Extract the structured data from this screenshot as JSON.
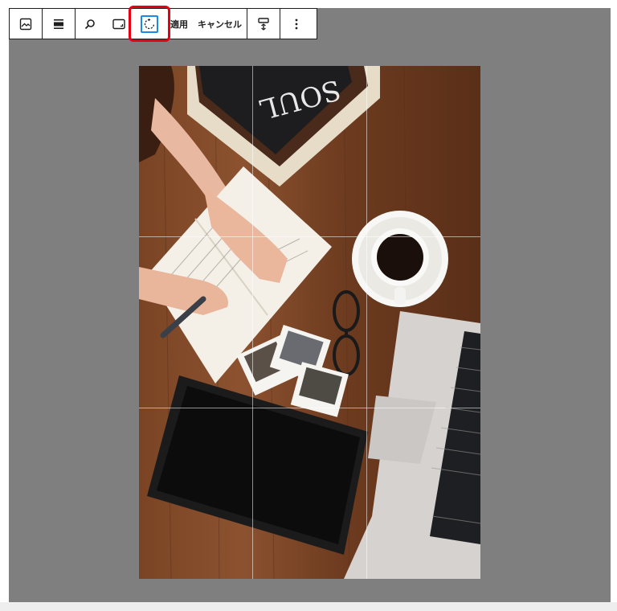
{
  "toolbar": {
    "buttons": [
      {
        "name": "block-type-image-button",
        "icon": "image-icon"
      },
      {
        "name": "align-button",
        "icon": "align-wide-icon"
      },
      {
        "name": "zoom-button",
        "icon": "search-icon"
      },
      {
        "name": "aspect-ratio-button",
        "icon": "aspect-ratio-icon"
      },
      {
        "name": "rotate-button",
        "icon": "rotate-icon"
      }
    ],
    "apply_label": "適用",
    "cancel_label": "キャンセル",
    "replace_icon": "text-caption-icon",
    "more_icon": "more-vertical-icon"
  },
  "image": {
    "subject": "desk-photo",
    "book_title": "SOUL",
    "grid": "3x3"
  },
  "colors": {
    "highlight": "#e60012",
    "active_accent": "#1e88e5",
    "canvas_bg": "#7f7f7f"
  }
}
